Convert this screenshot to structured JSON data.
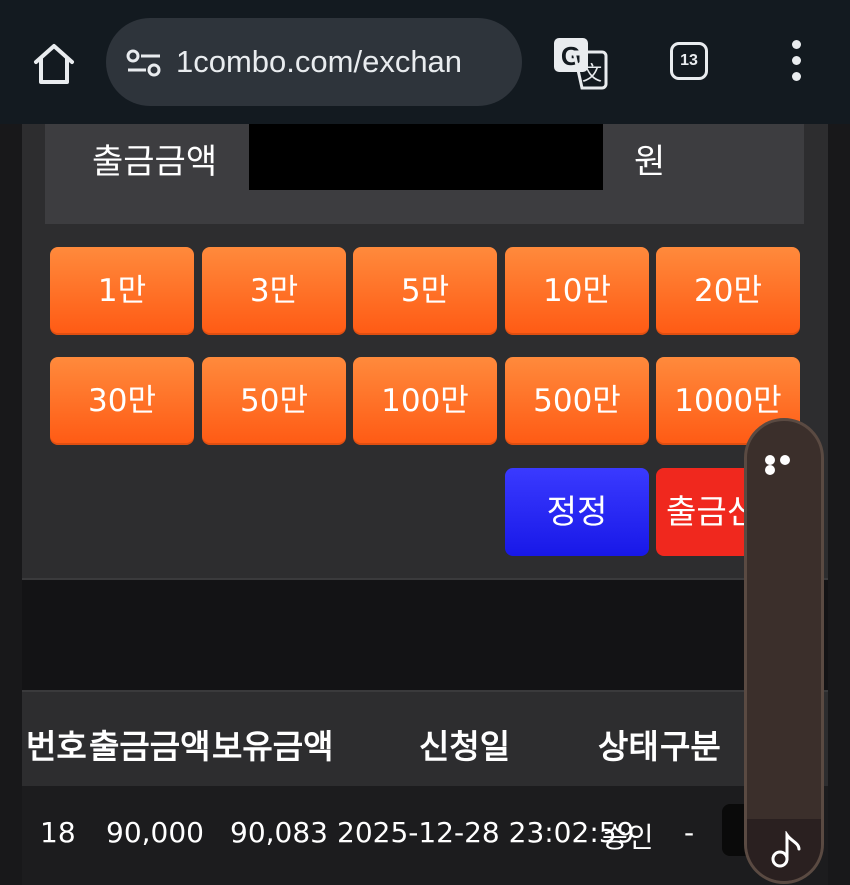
{
  "browser": {
    "url": "1combo.com/exchan",
    "tab_count": "13",
    "icons": [
      "home-icon",
      "site-settings-icon",
      "translate-icon",
      "tabs-icon",
      "more-vert-icon"
    ]
  },
  "withdraw": {
    "amount_label": "출금금액",
    "amount_value": "",
    "unit": "원",
    "quick_amounts": [
      "1만",
      "3만",
      "5만",
      "10만",
      "20만",
      "30만",
      "50만",
      "100만",
      "500만",
      "1000만"
    ],
    "correct_label": "정정",
    "submit_label": "출금신청"
  },
  "table": {
    "headers": [
      "번호",
      "출금금액",
      "보유금액",
      "신청일",
      "상태",
      "구분"
    ],
    "rows": [
      {
        "no": "18",
        "amount": "90,000",
        "balance": "90,083",
        "date": "2025-12-28 23:02:59",
        "status": "승인",
        "type": "-"
      }
    ]
  },
  "widget": {
    "icons": [
      "more-horizontal-icon",
      "music-note-icon"
    ]
  },
  "colors": {
    "orange": "#ff6a20",
    "blue": "#2020f0",
    "red": "#f0281e",
    "topbar": "#131a20"
  }
}
